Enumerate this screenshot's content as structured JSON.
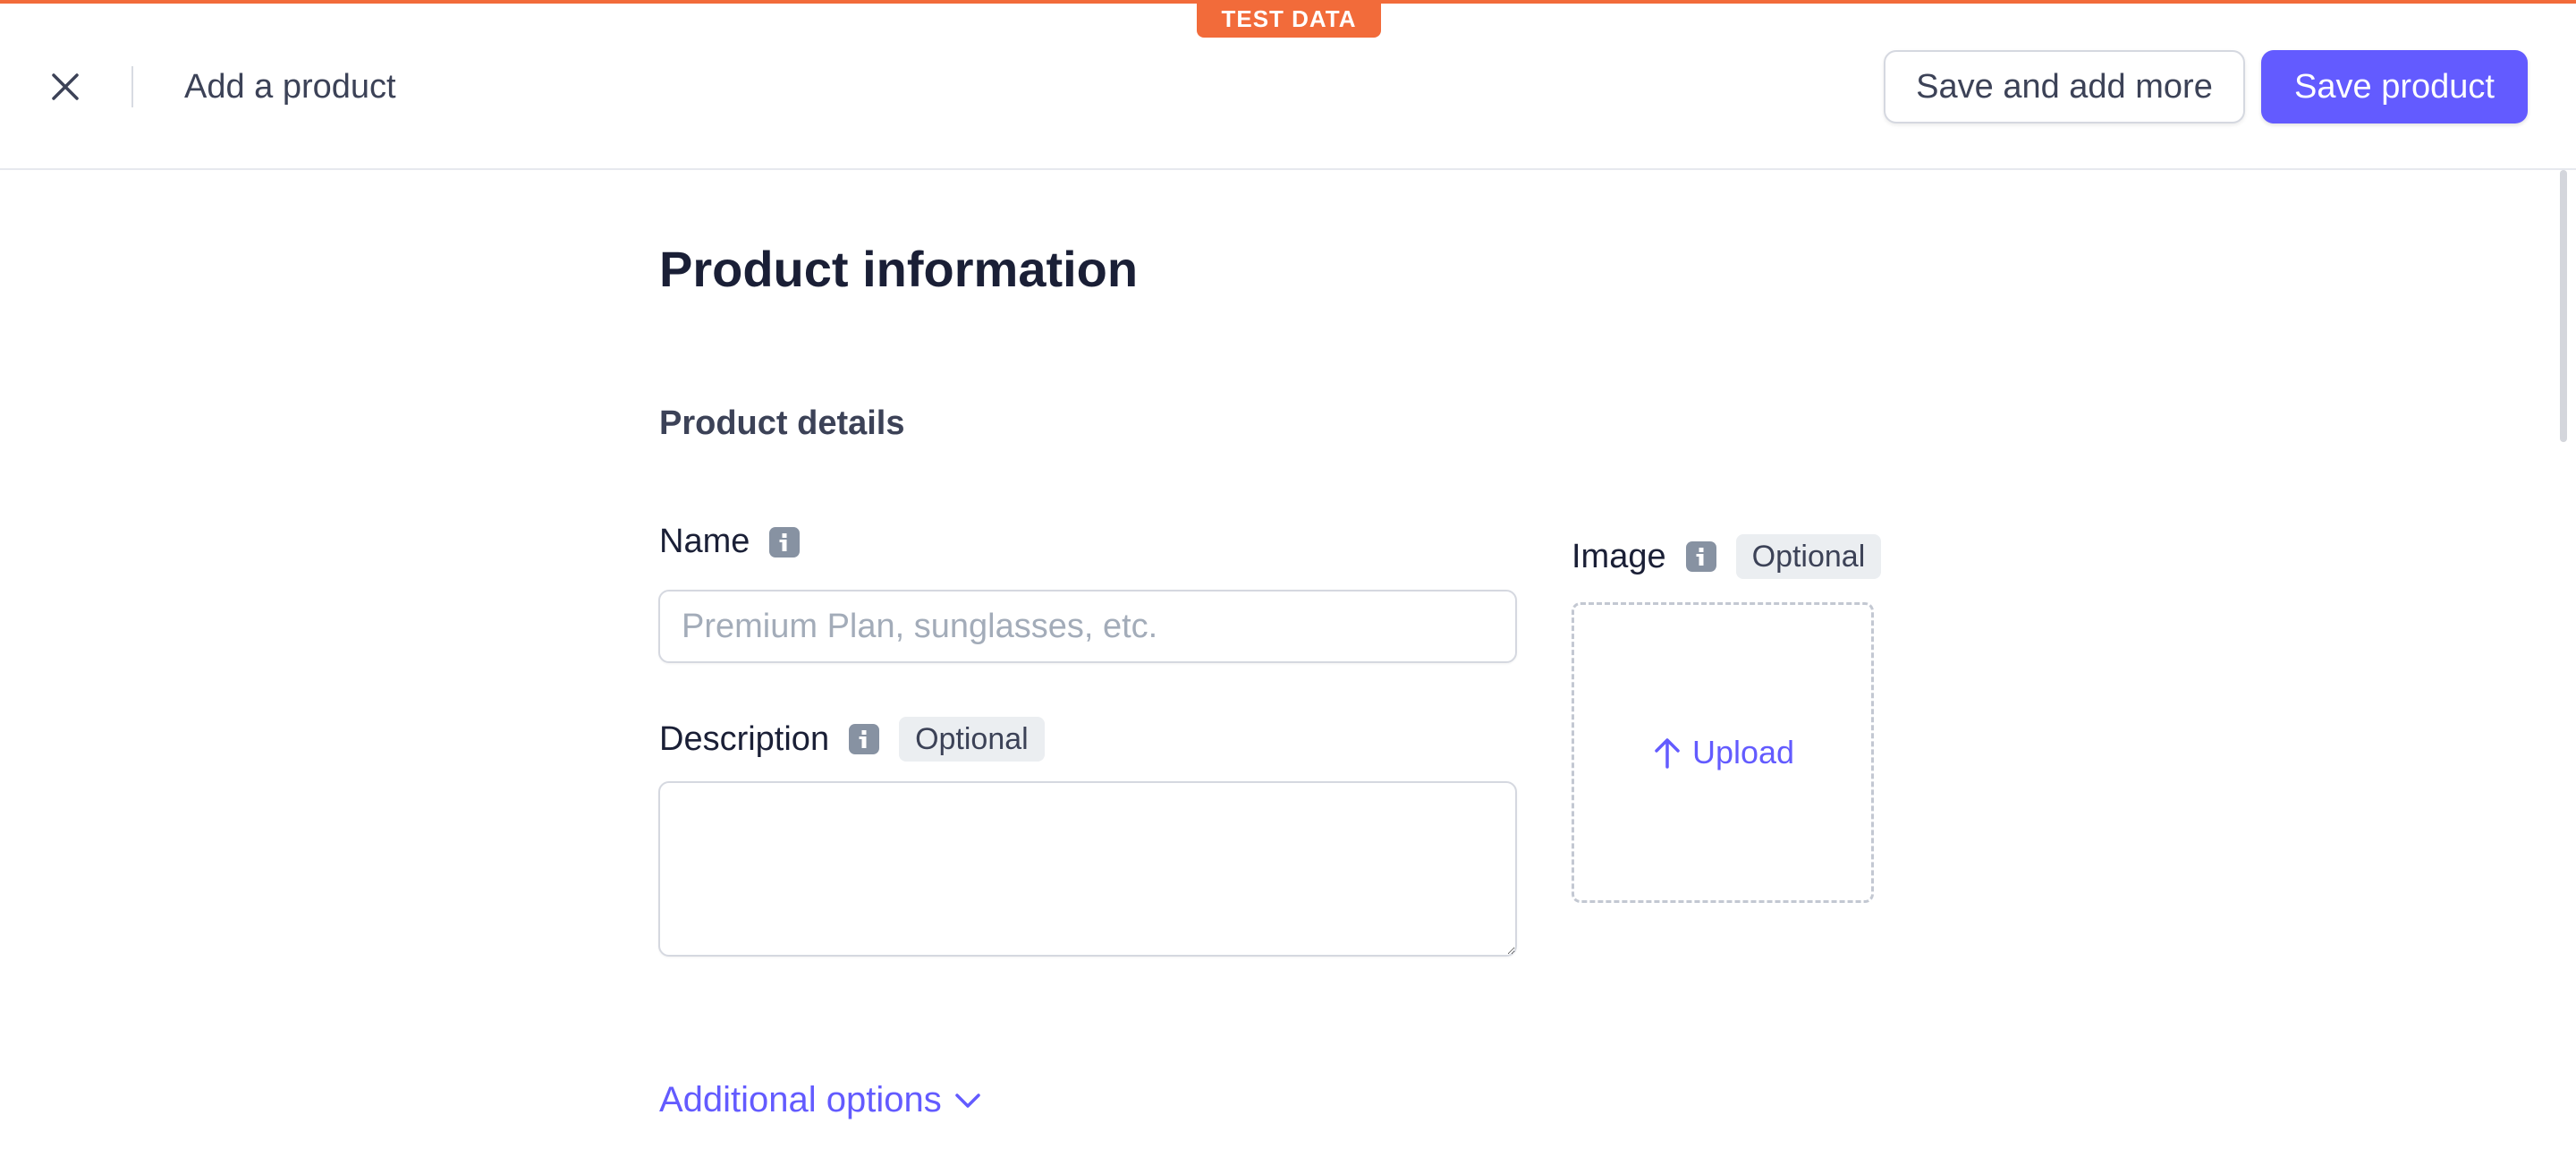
{
  "banner": {
    "label": "TEST DATA",
    "color": "#f26b3a"
  },
  "header": {
    "title": "Add a product",
    "close_icon": "close-icon",
    "save_more_label": "Save and add more",
    "save_label": "Save product",
    "accent": "#635bff"
  },
  "main": {
    "title": "Product information",
    "section_title": "Product details",
    "name": {
      "label": "Name",
      "icon": "info-icon",
      "placeholder": "Premium Plan, sunglasses, etc.",
      "value": ""
    },
    "description": {
      "label": "Description",
      "icon": "info-icon",
      "badge": "Optional",
      "value": ""
    },
    "image": {
      "label": "Image",
      "icon": "info-icon",
      "badge": "Optional",
      "upload_label": "Upload",
      "upload_icon": "arrow-up-icon"
    },
    "additional_options": {
      "label": "Additional options",
      "icon": "chevron-down-icon"
    }
  }
}
